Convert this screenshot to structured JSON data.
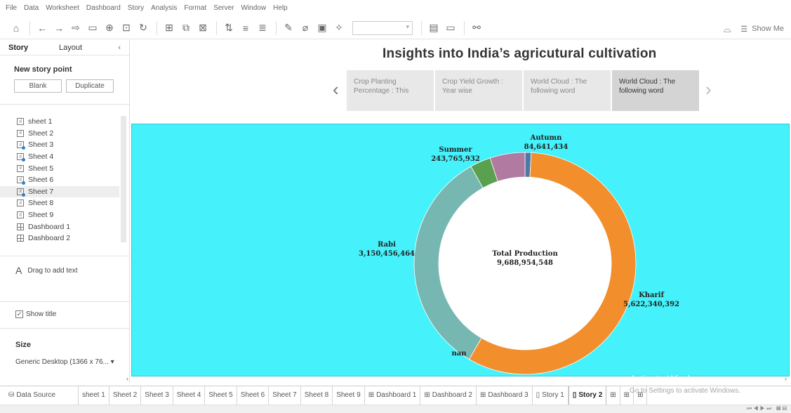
{
  "menu": [
    "File",
    "Data",
    "Worksheet",
    "Dashboard",
    "Story",
    "Analysis",
    "Format",
    "Server",
    "Window",
    "Help"
  ],
  "toolbar": {
    "showme_label": "Show Me"
  },
  "leftpanel": {
    "tab_story": "Story",
    "tab_layout": "Layout",
    "new_story_point": "New story point",
    "blank_label": "Blank",
    "duplicate_label": "Duplicate",
    "sheets": [
      "sheet 1",
      "Sheet 2",
      "Sheet 3",
      "Sheet 4",
      "Sheet 5",
      "Sheet 6",
      "Sheet 7",
      "Sheet 8",
      "Sheet 9",
      "Dashboard 1",
      "Dashboard 2"
    ],
    "drag_text": "Drag to add text",
    "show_title": "Show title",
    "size_heading": "Size",
    "size_value": "Generic Desktop (1366 x 76..."
  },
  "story": {
    "title": "Insights into India’s agricutural cultivation",
    "points": [
      {
        "line1": "Crop Planting",
        "line2": "Percentage : This"
      },
      {
        "line1": "Crop Yield Growth :",
        "line2": "Year wise"
      },
      {
        "line1": "World Cloud : The",
        "line2": "following word"
      },
      {
        "line1": "World Cloud : The",
        "line2": "following word"
      }
    ]
  },
  "chart_data": {
    "type": "pie",
    "center_label": "Total Production",
    "center_value": "9,688,954,548",
    "total": 9688954548,
    "slices": [
      {
        "name": "Autumn",
        "value": 84641434,
        "display": "84,641,434",
        "color": "#4e79a7"
      },
      {
        "name": "Kharif",
        "value": 5622340392,
        "display": "5,622,340,392",
        "color": "#f28e2b"
      },
      {
        "name": "nan",
        "value": 0,
        "display": "",
        "color": "#76b7b2"
      },
      {
        "name": "Rabi",
        "value": 3150456464,
        "display": "3,150,456,464",
        "color": "#76b7b2"
      },
      {
        "name": "Summer",
        "value": 243765932,
        "display": "243,765,932",
        "color": "#59a14f"
      },
      {
        "name": "",
        "value": 0,
        "display": "",
        "color": "#b07aa1"
      }
    ]
  },
  "tabs": [
    "sheet 1",
    "Sheet 2",
    "Sheet 3",
    "Sheet 4",
    "Sheet 5",
    "Sheet 6",
    "Sheet 7",
    "Sheet 8",
    "Sheet 9",
    "Dashboard 1",
    "Dashboard 2",
    "Dashboard 3",
    "Story 1",
    "Story 2"
  ],
  "data_source_label": "Data Source",
  "watermark": {
    "line1": "Activate Windows",
    "line2": "Go to Settings to activate Windows."
  }
}
